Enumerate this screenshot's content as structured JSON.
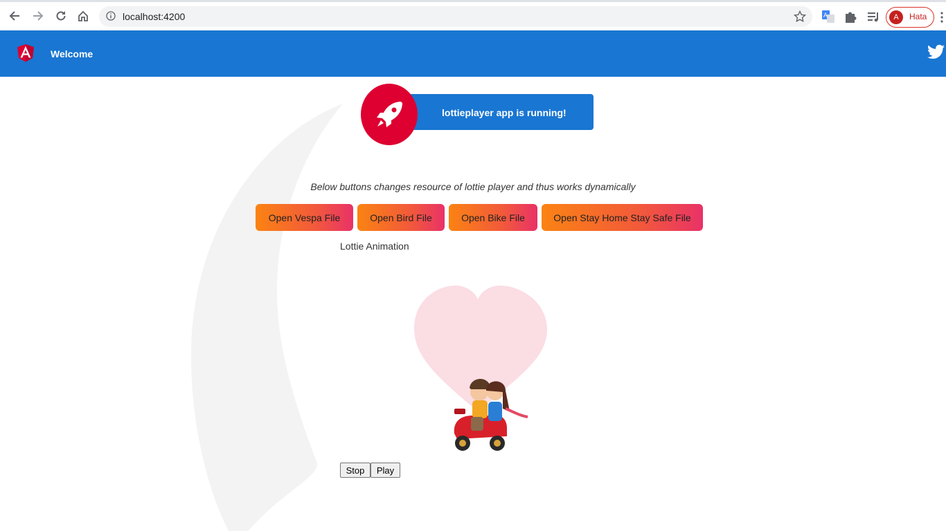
{
  "browser": {
    "url": "localhost:4200",
    "profile_initial": "A",
    "profile_label": "Hata"
  },
  "toolbar": {
    "title": "Welcome",
    "accent_color": "#1976d2"
  },
  "card": {
    "text": "lottieplayer app is running!"
  },
  "main": {
    "subtitle": "Below buttons changes resource of lottie player and thus works dynamically",
    "buttons": [
      {
        "label": "Open Vespa File"
      },
      {
        "label": "Open Bird File"
      },
      {
        "label": "Open Bike File"
      },
      {
        "label": "Open Stay Home Stay Safe File"
      }
    ],
    "animation_label": "Lottie Animation",
    "controls": {
      "stop_label": "Stop",
      "play_label": "Play"
    }
  },
  "icons": {
    "back": "back-arrow-icon",
    "forward": "forward-arrow-icon",
    "reload": "reload-icon",
    "home": "home-icon",
    "info": "info-icon",
    "bookmark": "star-icon",
    "translate": "translate-icon",
    "extensions": "puzzle-icon",
    "reading_list": "reading-list-icon",
    "menu": "kebab-menu-icon",
    "angular": "angular-logo",
    "twitter": "twitter-icon",
    "rocket": "rocket-icon"
  }
}
